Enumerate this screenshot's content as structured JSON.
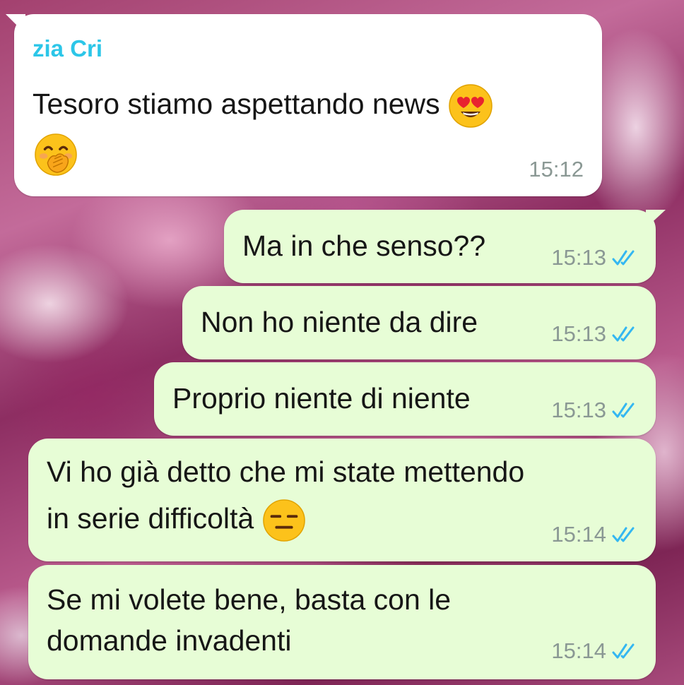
{
  "messages": [
    {
      "direction": "incoming",
      "sender": "zia Cri",
      "lines": [
        "Tesoro stiamo aspettando news"
      ],
      "emojis": [
        "heart-eyes-emoji",
        "hand-over-mouth-emoji"
      ],
      "time": "15:12"
    },
    {
      "direction": "outgoing",
      "lines": [
        "Ma in che senso??"
      ],
      "time": "15:13",
      "status": "read"
    },
    {
      "direction": "outgoing",
      "lines": [
        "Non ho niente da dire"
      ],
      "time": "15:13",
      "status": "read"
    },
    {
      "direction": "outgoing",
      "lines": [
        "Proprio niente di niente"
      ],
      "time": "15:13",
      "status": "read"
    },
    {
      "direction": "outgoing",
      "lines": [
        "Vi ho già detto che mi state mettendo",
        "in serie difficoltà"
      ],
      "emojis": [
        "expressionless-emoji"
      ],
      "time": "15:14",
      "status": "read"
    },
    {
      "direction": "outgoing",
      "lines": [
        "Se mi volete bene, basta con le",
        "domande invadenti"
      ],
      "time": "15:14",
      "status": "read"
    }
  ],
  "colors": {
    "incoming_bubble": "#ffffff",
    "outgoing_bubble": "#e7fdd6",
    "sender_name": "#2cc6e8",
    "read_ticks": "#34b7f1",
    "timestamp": "#8a9894"
  }
}
